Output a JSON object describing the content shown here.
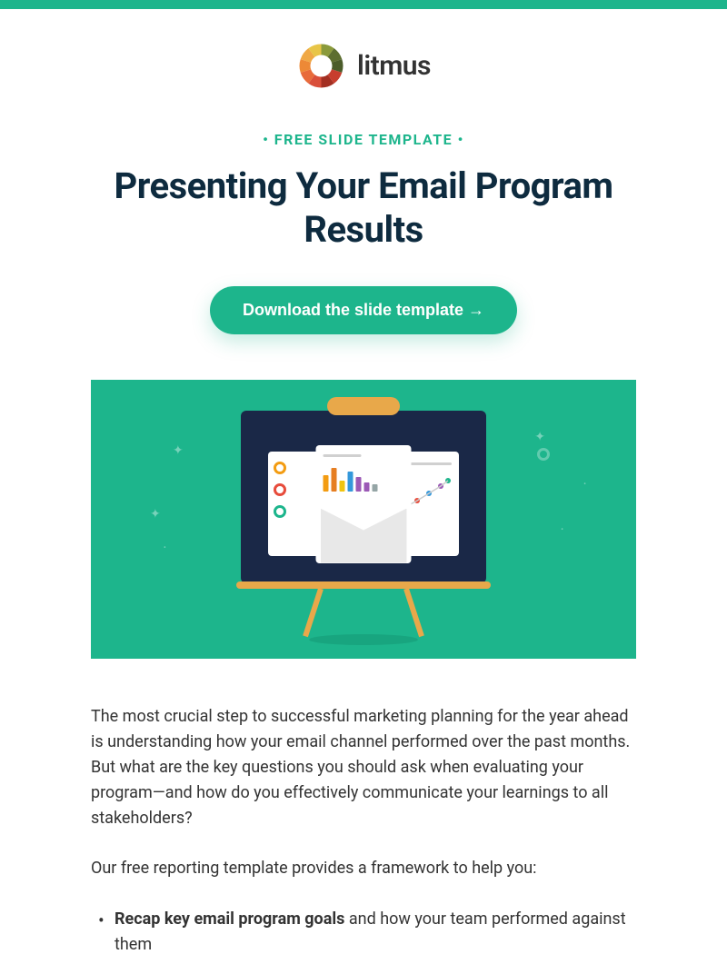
{
  "brand": {
    "name": "litmus"
  },
  "eyebrow": "• FREE SLIDE TEMPLATE •",
  "headline": "Presenting Your Email Program Results",
  "cta": {
    "label": "Download the slide template →"
  },
  "body": {
    "paragraph1": "The most crucial step to successful marketing planning for the year ahead is understanding how your email channel performed over the past months. But what are the key questions you should ask when evaluating your program—and how do you effectively communicate your learnings to all stakeholders?",
    "paragraph2": "Our free reporting template provides a framework to help you:",
    "bullets": [
      {
        "bold": "Recap key email program goals",
        "rest": " and how your team performed against them"
      }
    ]
  },
  "colors": {
    "accent": "#1db58c",
    "dark": "#0e2b3f"
  }
}
